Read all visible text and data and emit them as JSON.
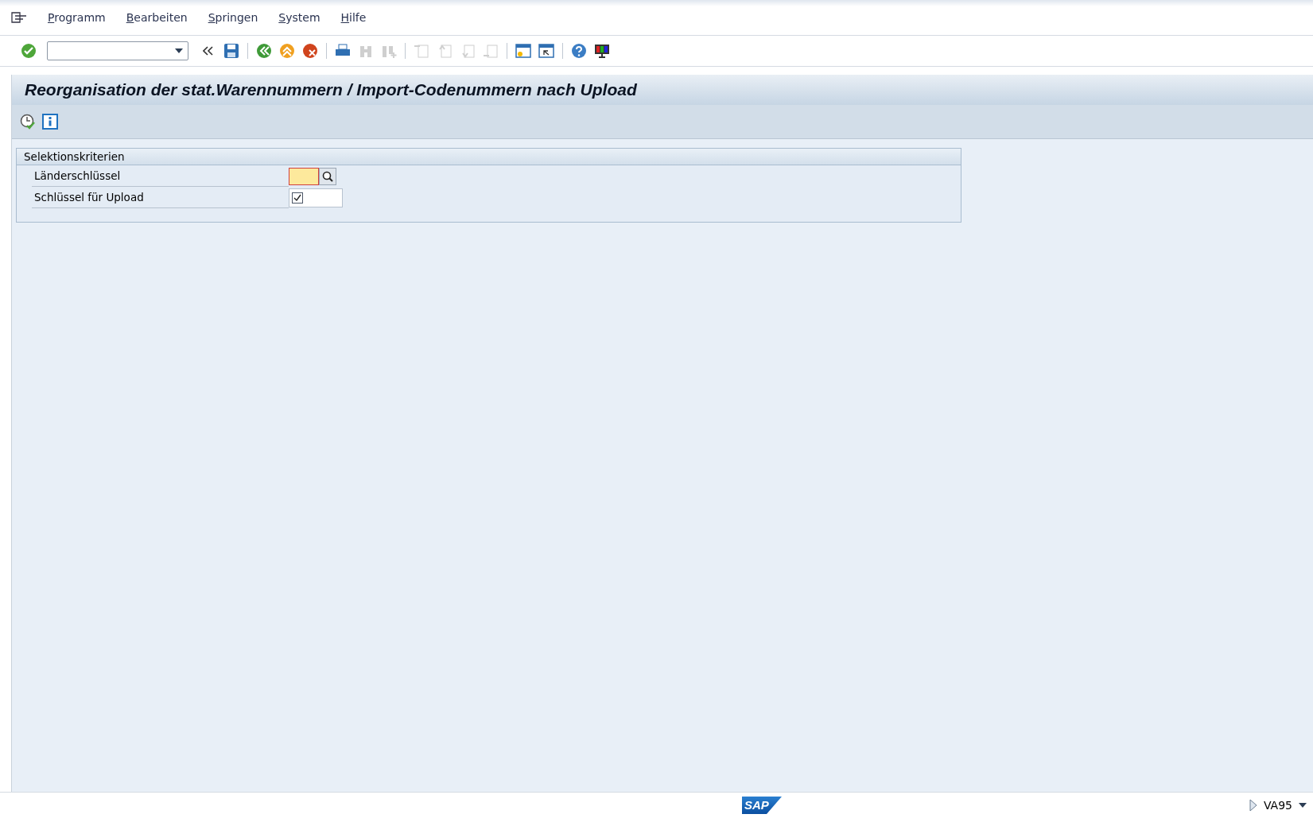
{
  "menu": [
    "Programm",
    "Bearbeiten",
    "Springen",
    "System",
    "Hilfe"
  ],
  "toolbar": [
    {
      "kind": "button",
      "disabled": false
    },
    {
      "kind": "command-field"
    },
    {
      "kind": "button",
      "disabled": false
    },
    {
      "kind": "button",
      "disabled": false
    },
    {
      "kind": "separator"
    },
    {
      "kind": "button",
      "disabled": false
    },
    {
      "kind": "button",
      "disabled": false
    },
    {
      "kind": "button",
      "disabled": false
    },
    {
      "kind": "separator"
    },
    {
      "kind": "button",
      "disabled": false
    },
    {
      "kind": "button",
      "disabled": true
    },
    {
      "kind": "button",
      "disabled": true
    },
    {
      "kind": "separator"
    },
    {
      "kind": "button",
      "disabled": true
    },
    {
      "kind": "button",
      "disabled": true
    },
    {
      "kind": "button",
      "disabled": true
    },
    {
      "kind": "button",
      "disabled": true
    },
    {
      "kind": "separator"
    },
    {
      "kind": "button",
      "disabled": false
    },
    {
      "kind": "button",
      "disabled": false
    },
    {
      "kind": "separator"
    },
    {
      "kind": "button",
      "disabled": false
    },
    {
      "kind": "button",
      "disabled": false
    }
  ],
  "title": "Reorganisation der stat.Warennummern / Import-Codenummern nach Upload",
  "group": {
    "title": "Selektionskriterien",
    "fields": [
      {
        "label": "Länderschlüssel",
        "kind": "input",
        "focused": true
      },
      {
        "label": "Schlüssel für Upload",
        "kind": "checkbox",
        "checked": true
      }
    ]
  },
  "status": {
    "logo_text": "SAP",
    "transaction": "VA95"
  }
}
